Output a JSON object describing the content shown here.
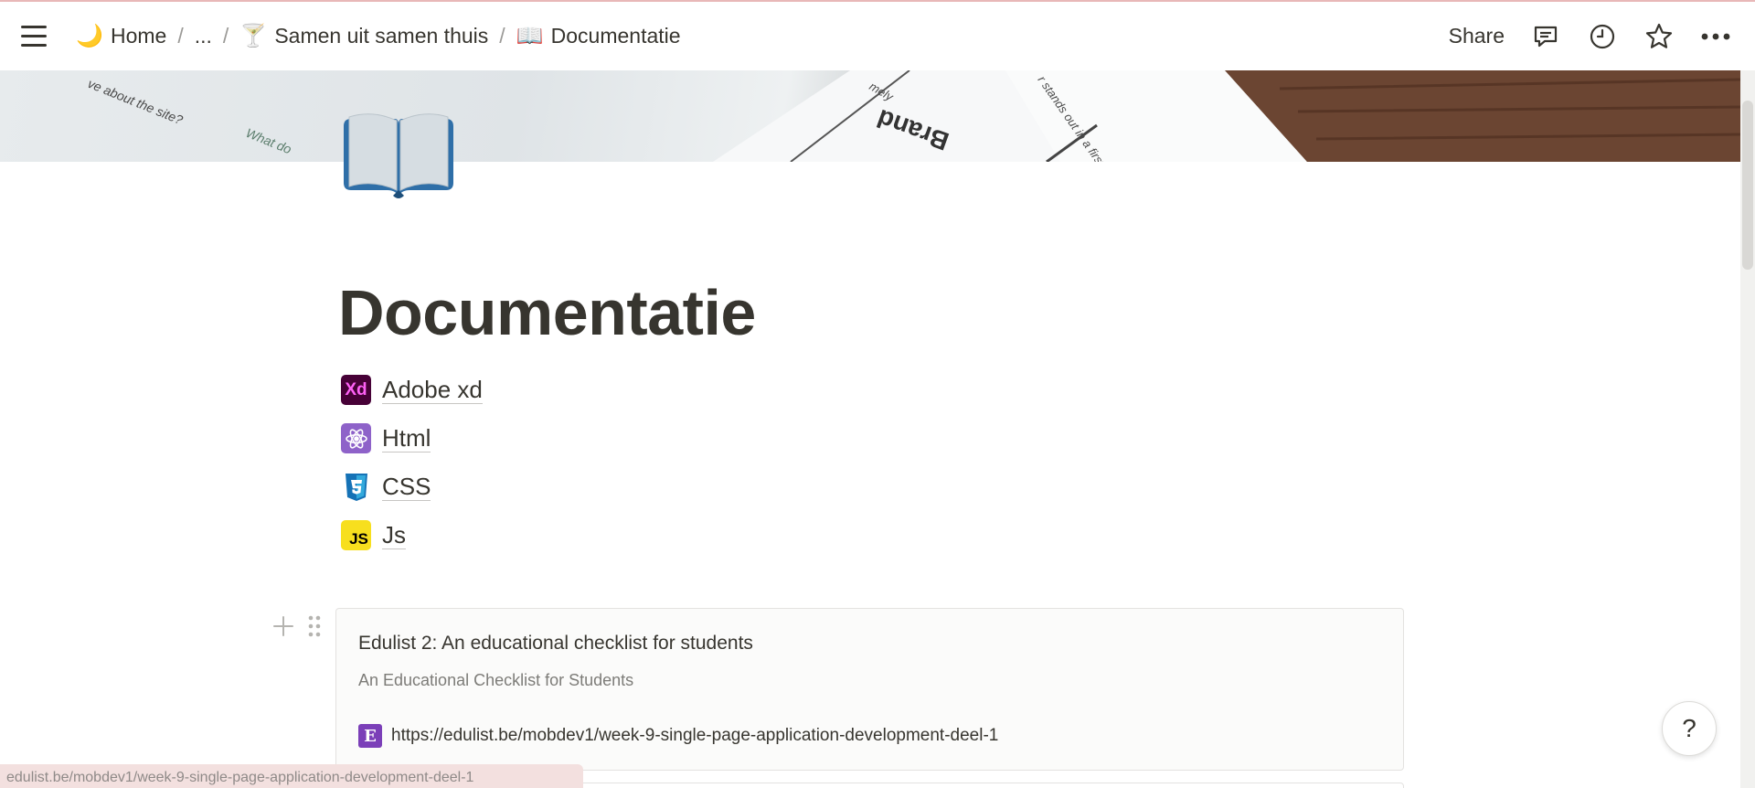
{
  "topbar": {
    "breadcrumbs": [
      {
        "emoji": "🌙",
        "label": "Home"
      },
      {
        "label": "..."
      },
      {
        "emoji": "🍸",
        "label": "Samen uit samen thuis"
      },
      {
        "emoji": "📖",
        "label": "Documentatie"
      }
    ],
    "separator": "/",
    "share_label": "Share",
    "icons": [
      "menu-icon",
      "comment-icon",
      "clock-icon",
      "star-icon",
      "more-icon"
    ]
  },
  "cover": {
    "texts": [
      "ve about the site?",
      "What do",
      "mely",
      "Brand",
      "r stands out in a first"
    ]
  },
  "page": {
    "icon": "open-book-icon",
    "title": "Documentatie",
    "links": [
      {
        "label": "Adobe xd",
        "icon": "adobe-xd-icon",
        "icon_text": "Xd",
        "color": "#470137",
        "icon_fg": "#ff61f6"
      },
      {
        "label": "Html",
        "icon": "atom-icon",
        "color": "#8e62c9",
        "icon_fg": "#ffffff"
      },
      {
        "label": "CSS",
        "icon": "css3-icon",
        "color": "#1572b6",
        "icon_fg": "#ffffff"
      },
      {
        "label": "Js",
        "icon": "javascript-icon",
        "icon_text": "JS",
        "color": "#f7df1e",
        "icon_fg": "#000000"
      }
    ]
  },
  "bookmark": {
    "title": "Edulist 2: An educational checklist for students",
    "description": "An Educational Checklist for Students",
    "favicon_text": "E",
    "url": "https://edulist.be/mobdev1/week-9-single-page-application-development-deel-1"
  },
  "status_bar": {
    "url": "edulist.be/mobdev1/week-9-single-page-application-development-deel-1"
  },
  "help_label": "?"
}
